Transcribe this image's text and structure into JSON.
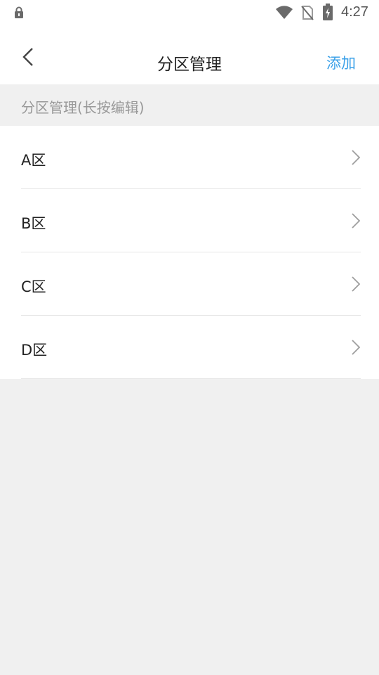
{
  "status_bar": {
    "time": "4:27",
    "icons": [
      "lock-icon",
      "wifi-icon",
      "no-sim-icon",
      "battery-charging-icon"
    ]
  },
  "header": {
    "back_icon": "chevron-left-icon",
    "title": "分区管理",
    "add_label": "添加"
  },
  "section": {
    "label": "分区管理(长按编辑)"
  },
  "zones": [
    {
      "label": "A区"
    },
    {
      "label": "B区"
    },
    {
      "label": "C区"
    },
    {
      "label": "D区"
    }
  ],
  "colors": {
    "accent": "#3aa0e8",
    "background": "#f0f0f0",
    "divider": "#e6e6e6"
  }
}
